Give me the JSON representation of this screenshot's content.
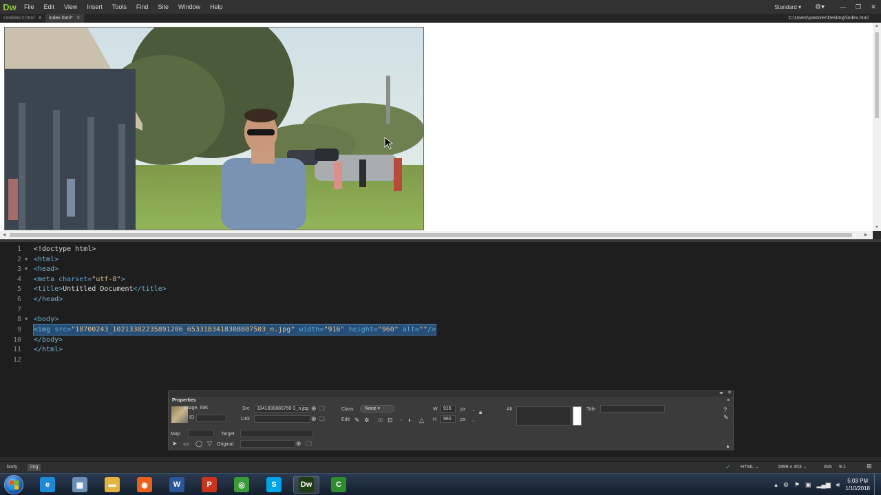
{
  "app": {
    "logo": "Dw",
    "menu": [
      "File",
      "Edit",
      "View",
      "Insert",
      "Tools",
      "Find",
      "Site",
      "Window",
      "Help"
    ],
    "workspace": "Standard",
    "window_controls": [
      "—",
      "❐",
      "✕"
    ]
  },
  "tabs": [
    {
      "label": "Untitled-2.html",
      "active": false
    },
    {
      "label": "index.html*",
      "active": true
    }
  ],
  "filepath": "C:\\Users\\pastorer\\Desktop\\index.html",
  "code": {
    "line_numbers": [
      "1",
      "2",
      "3",
      "4",
      "5",
      "6",
      "7",
      "8",
      "9",
      "10",
      "11",
      "12"
    ],
    "l1": "<!doctype html>",
    "l2": "<html>",
    "l3": "<head>",
    "l4_open": "<meta ",
    "l4_attr": "charset=",
    "l4_val": "\"utf-8\"",
    "l4_close": ">",
    "l5_open": "<title>",
    "l5_text": "Untitled Document",
    "l5_close": "</title>",
    "l6": "</head>",
    "l8": "<body>",
    "l9_tag": "<img ",
    "l9_src_attr": "src=",
    "l9_src_val": "\"18700243_10213382235891206_6533183418308807503_n.jpg\"",
    "l9_w_attr": " width=",
    "l9_w_val": "\"916\"",
    "l9_h_attr": " height=",
    "l9_h_val": "\"960\"",
    "l9_alt_attr": " alt=",
    "l9_alt_val": "\"\"",
    "l9_end": "/>",
    "l10": "</body>",
    "l11": "</html>"
  },
  "properties": {
    "title": "Properties",
    "type": "Image, 69K",
    "id_label": "ID",
    "src_label": "Src",
    "src_value": "3341830880750 3_n.jpg",
    "link_label": "Link",
    "class_label": "Class",
    "class_value": "None",
    "edit_label": "Edit",
    "w_label": "W",
    "w_value": "916",
    "h_label": "H",
    "h_value": "960",
    "unit": "px",
    "alt_label": "Alt",
    "title_label": "Title",
    "map_label": "Map",
    "target_label": "Target",
    "original_label": "Original"
  },
  "status": {
    "crumbs": [
      "body",
      "img"
    ],
    "language": "HTML",
    "dimensions": "1899 x 453",
    "mode": "INS",
    "position": "9:1"
  },
  "taskbar": {
    "apps": [
      {
        "name": "internet-explorer",
        "glyph": "e",
        "color": "#1e8ad6"
      },
      {
        "name": "windows-explorer-library",
        "glyph": "▦",
        "color": "#6a8fb8"
      },
      {
        "name": "file-explorer",
        "glyph": "▬",
        "color": "#e3b340"
      },
      {
        "name": "firefox",
        "glyph": "◉",
        "color": "#e8611c"
      },
      {
        "name": "word",
        "glyph": "W",
        "color": "#2a5699"
      },
      {
        "name": "powerpoint",
        "glyph": "P",
        "color": "#c9341c"
      },
      {
        "name": "chrome",
        "glyph": "◎",
        "color": "#3b9a3b"
      },
      {
        "name": "skype",
        "glyph": "S",
        "color": "#00a4e8"
      },
      {
        "name": "dreamweaver",
        "glyph": "Dw",
        "color": "#1d3e12"
      },
      {
        "name": "camtasia",
        "glyph": "C",
        "color": "#2e8b2e"
      }
    ],
    "time": "5:03 PM",
    "date": "1/10/2018"
  }
}
